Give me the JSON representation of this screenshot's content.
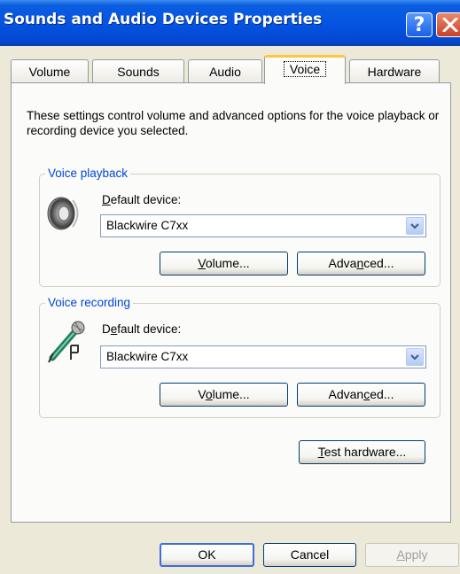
{
  "window": {
    "title": "Sounds and Audio Devices Properties"
  },
  "tabs": [
    {
      "label": "Volume"
    },
    {
      "label": "Sounds"
    },
    {
      "label": "Audio"
    },
    {
      "label": "Voice"
    },
    {
      "label": "Hardware"
    }
  ],
  "active_tab": "Voice",
  "description": "These settings control volume and advanced options for the voice playback or recording device you selected.",
  "playback": {
    "group_label": "Voice playback",
    "default_device_label": {
      "pre": "",
      "accel": "D",
      "post": "efault device:"
    },
    "device_value": "Blackwire C7xx",
    "volume_button": {
      "pre": "",
      "accel": "V",
      "post": "olume..."
    },
    "advanced_button": {
      "pre": "Adva",
      "accel": "n",
      "post": "ced..."
    }
  },
  "recording": {
    "group_label": "Voice recording",
    "default_device_label": {
      "pre": "D",
      "accel": "e",
      "post": "fault device:"
    },
    "device_value": "Blackwire C7xx",
    "volume_button": {
      "pre": "V",
      "accel": "o",
      "post": "lume..."
    },
    "advanced_button": {
      "pre": "Advan",
      "accel": "c",
      "post": "ed..."
    }
  },
  "test_hardware_button": {
    "pre": "",
    "accel": "T",
    "post": "est hardware..."
  },
  "footer": {
    "ok": "OK",
    "cancel": "Cancel",
    "apply": {
      "pre": "",
      "accel": "A",
      "post": "pply"
    }
  },
  "icons": {
    "help": "help-icon",
    "close": "close-icon",
    "speaker": "speaker-icon",
    "microphone": "microphone-icon",
    "dropdown": "chevron-down-icon"
  },
  "colors": {
    "titlebar": "#0554e3",
    "group_label": "#0046d5",
    "active_tab_highlight": "#ffc83c",
    "dialog_background": "#ece9d8"
  }
}
